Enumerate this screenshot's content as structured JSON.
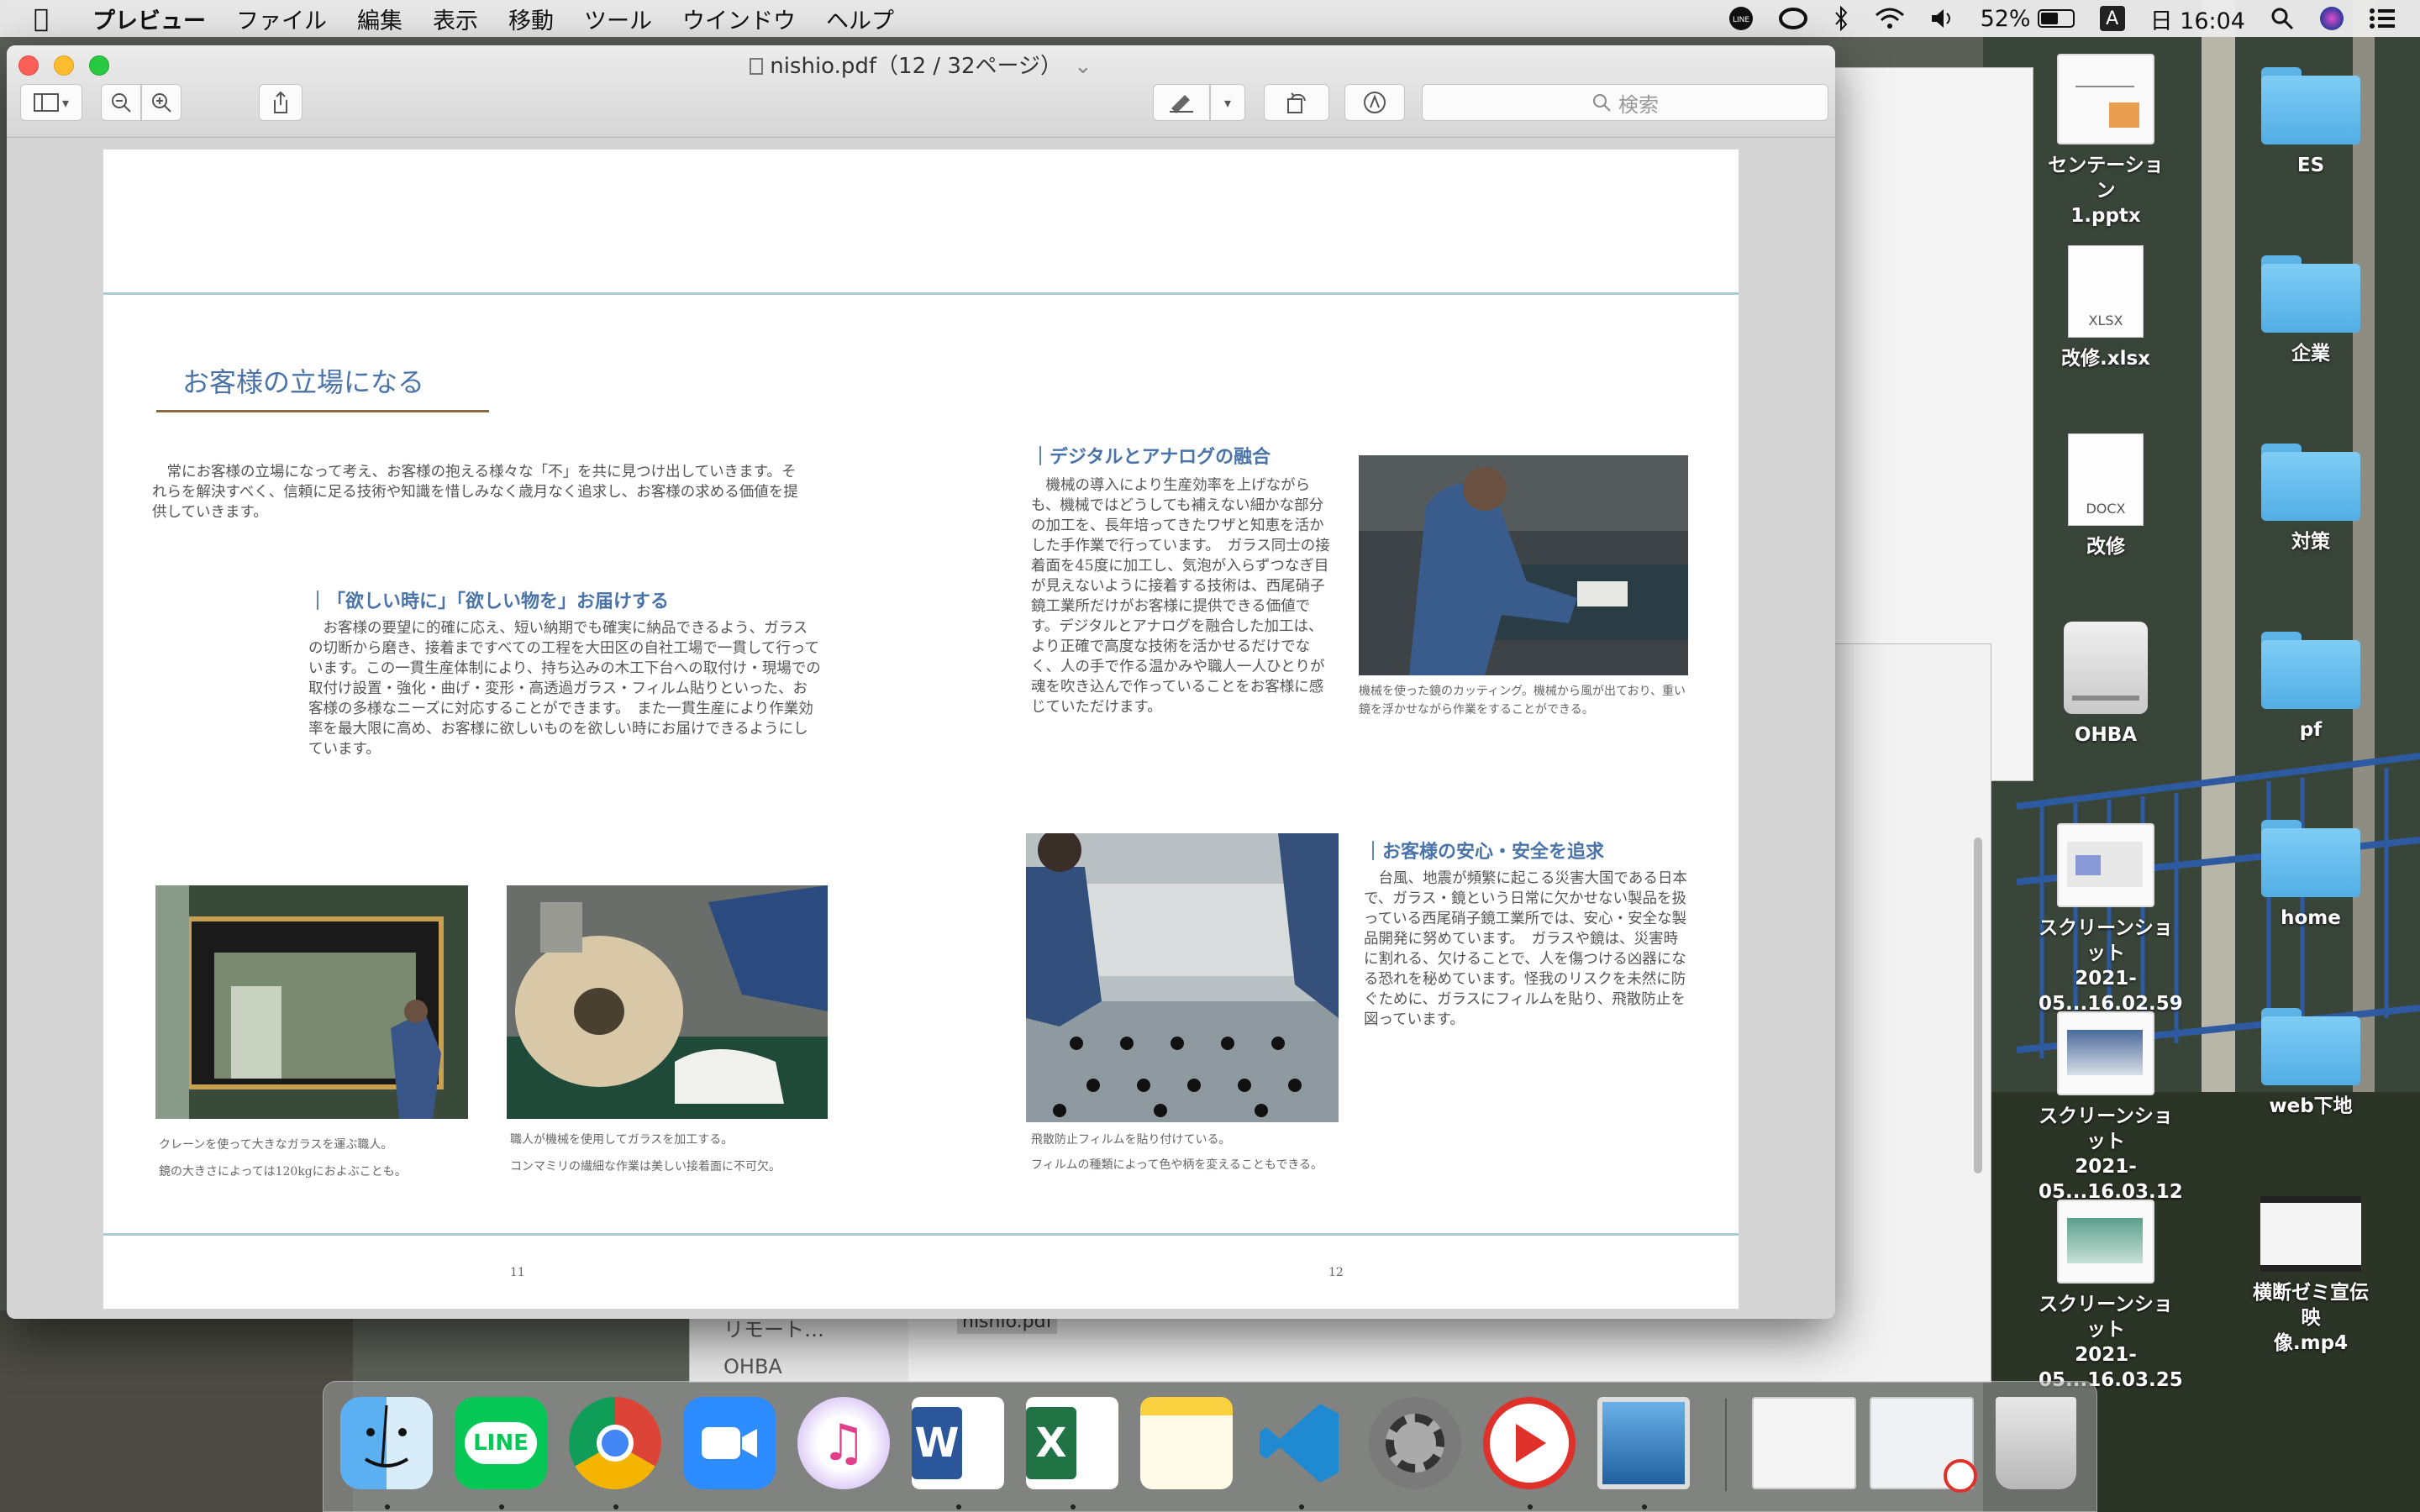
{
  "menubar": {
    "app_name": "プレビュー",
    "menus": [
      "ファイル",
      "編集",
      "表示",
      "移動",
      "ツール",
      "ウインドウ",
      "ヘルプ"
    ],
    "battery": "52%",
    "clock": "日 16:04",
    "input_indicator": "A"
  },
  "window": {
    "title": "nishio.pdf（12 / 32ページ）",
    "search_placeholder": "検索"
  },
  "page": {
    "left_heading": "お客様の立場になる",
    "intro": "常にお客様の立場になって考え、お客様の抱える様々な「不」を共に見つけ出していきます。それらを解決すべく、信頼に足る技術や知識を惜しみなく歳月なく追求し、お客様の求める価値を提供していきます。",
    "section1": {
      "title": "｜「欲しい時に」「欲しい物を」お届けする",
      "body": "お客様の要望に的確に応え、短い納期でも確実に納品できるよう、ガラスの切断から磨き、接着まですべての工程を大田区の自社工場で一貫して行っています。この一貫生産体制により、持ち込みの木工下台への取付け・現場での取付け設置・強化・曲げ・変形・高透過ガラス・フィルム貼りといった、お客様の多様なニーズに対応することができます。　また一貫生産により作業効率を最大限に高め、お客様に欲しいものを欲しい時にお届けできるようにしています。"
    },
    "section2": {
      "title": "｜デジタルとアナログの融合",
      "body": "機械の導入により生産効率を上げながらも、機械ではどうしても補えない細かな部分の加工を、長年培ってきたワザと知恵を活かした手作業で行っています。　ガラス同士の接着面を45度に加工し、気泡が入らずつなぎ目が見えないように接着する技術は、西尾硝子鏡工業所だけがお客様に提供できる価値です。デジタルとアナログを融合した加工は、より正確で高度な技術を活かせるだけでなく、人の手で作る温かみや職人一人ひとりが魂を吹き込んで作っていることをお客様に感じていただけます。",
      "caption": "機械を使った鏡のカッティング。機械から風が出ており、重い鏡を浮かせながら作業をすることができる。"
    },
    "section3": {
      "title": "｜お客様の安心・安全を追求",
      "body": "台風、地震が頻繁に起こる災害大国である日本で、ガラス・鏡という日常に欠かせない製品を扱っている西尾硝子鏡工業所では、安心・安全な製品開発に努めています。　ガラスや鏡は、災害時に割れる、欠けることで、人を傷つける凶器になる恐れを秘めています。怪我のリスクを未然に防ぐために、ガラスにフィルムを貼り、飛散防止を図っています。"
    },
    "captions": {
      "crane": [
        "クレーンを使って大きなガラスを運ぶ職人。",
        "鏡の大きさによっては120kgにおよぶことも。"
      ],
      "grinder": [
        "職人が機械を使用してガラスを加工する。",
        "コンマミリの繊細な作業は美しい接着面に不可欠。"
      ],
      "film": [
        "飛散防止フィルムを貼り付けている。",
        "フィルムの種類によって色や柄を変えることもできる。"
      ]
    },
    "page_left": "11",
    "page_right": "12"
  },
  "background_window": {
    "sidebar_item_1": "リモート…",
    "sidebar_item_2": "OHBA",
    "file_label": "nishio.pdf"
  },
  "desktop": {
    "icons_left": [
      {
        "label": "センテーション\n1.pptx",
        "kind": "file"
      },
      {
        "label": "改修.xlsx",
        "kind": "xlsx",
        "badge": "XLSX"
      },
      {
        "label": "改修",
        "kind": "docx",
        "badge": "DOCX"
      },
      {
        "label": "OHBA",
        "kind": "drive"
      },
      {
        "label": "スクリーンショット\n2021-05...16.02.59",
        "kind": "screenshot"
      },
      {
        "label": "スクリーンショット\n2021-05...16.03.12",
        "kind": "screenshot"
      },
      {
        "label": "スクリーンショット\n2021-05...16.03.25",
        "kind": "screenshot"
      }
    ],
    "icons_right": [
      {
        "label": "ES"
      },
      {
        "label": "企業"
      },
      {
        "label": "対策"
      },
      {
        "label": "pf"
      },
      {
        "label": "home"
      },
      {
        "label": "web下地"
      },
      {
        "label": "横断ゼミ宣伝映\n像.mp4",
        "kind": "video"
      }
    ]
  },
  "dock": {
    "apps": [
      "finder",
      "line",
      "chrome",
      "zoom",
      "music",
      "word",
      "excel",
      "notes",
      "vscode",
      "system-preferences",
      "player",
      "preview",
      "finder-window",
      "screenshot-video",
      "trash"
    ],
    "word_letter": "W",
    "excel_letter": "X",
    "line_text": "LINE"
  },
  "colors": {
    "heading_blue": "#4a73a8",
    "rule_teal": "#a9cdd3",
    "folder_blue": "#6cc0ef"
  }
}
